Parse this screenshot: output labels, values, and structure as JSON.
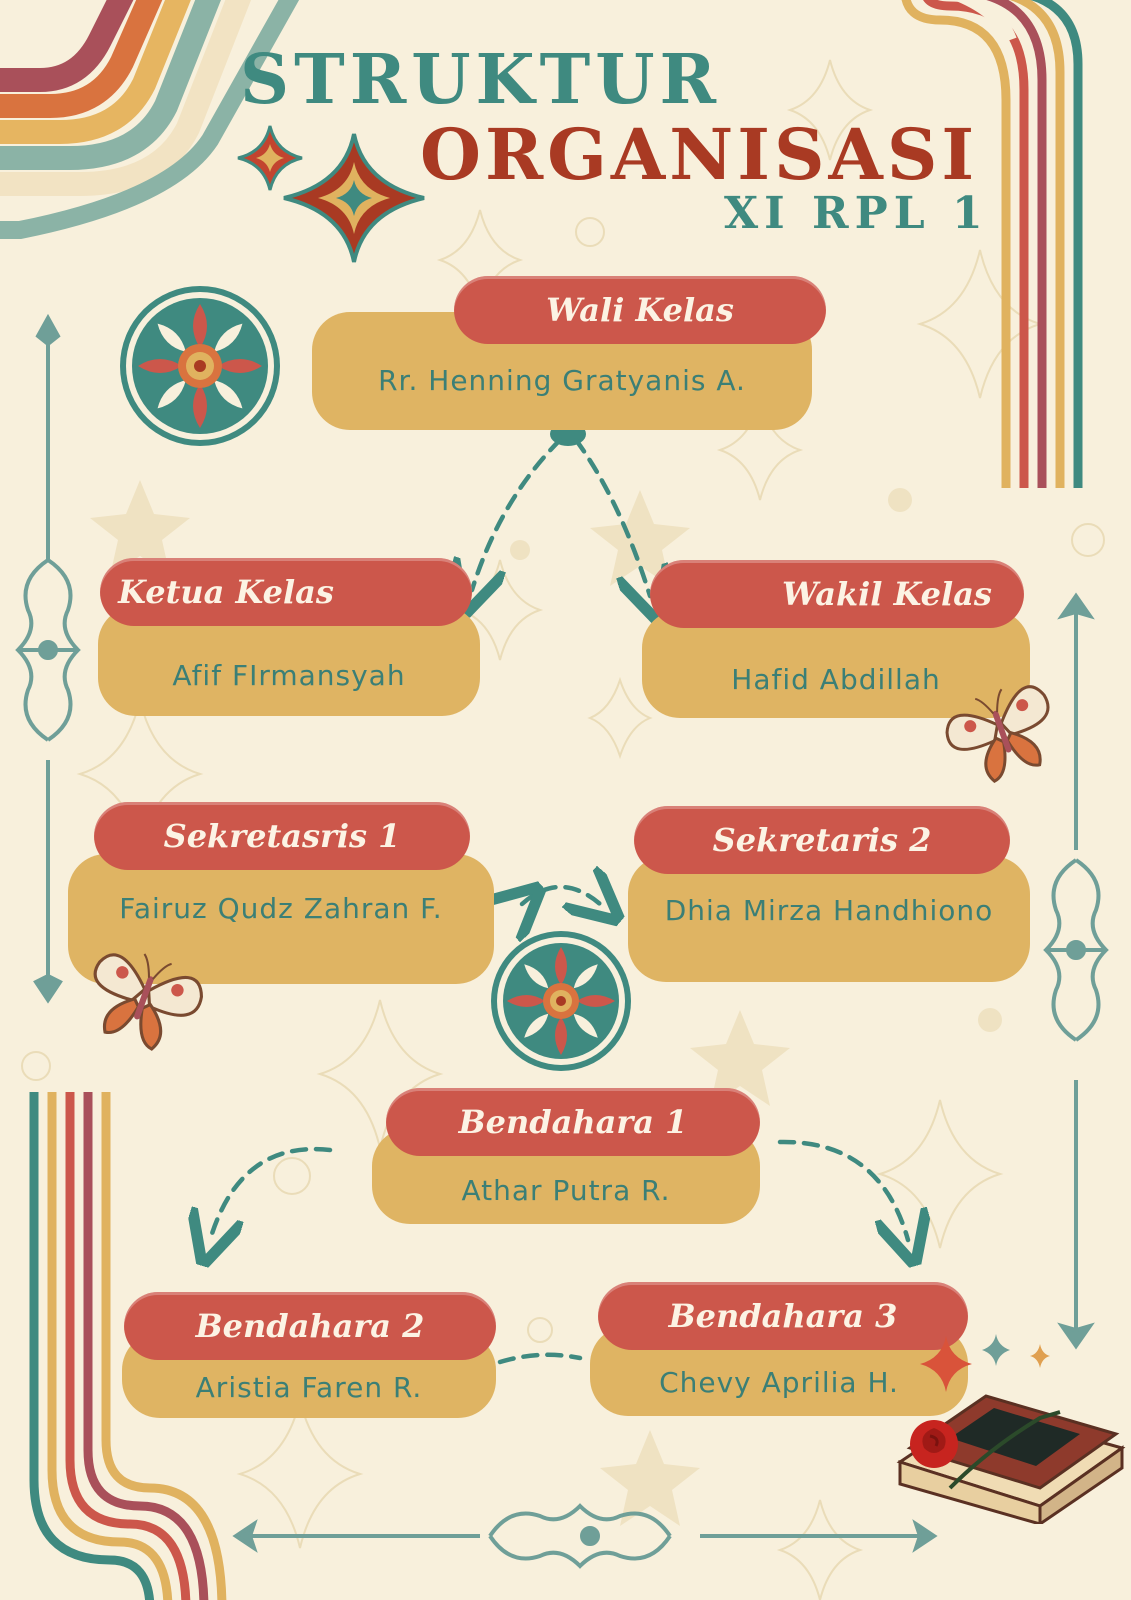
{
  "title": {
    "line1": "STRUKTUR",
    "line2": "ORGANISASI",
    "line3": "XI RPL 1"
  },
  "positions": [
    {
      "id": "wali",
      "role": "Wali Kelas",
      "name": "Rr. Henning Gratyanis A."
    },
    {
      "id": "ketua",
      "role": "Ketua Kelas",
      "name": "Afif FIrmansyah"
    },
    {
      "id": "wakil",
      "role": "Wakil Kelas",
      "name": "Hafid Abdillah"
    },
    {
      "id": "sek1",
      "role": "Sekretasris 1",
      "name": "Fairuz Qudz Zahran F."
    },
    {
      "id": "sek2",
      "role": "Sekretaris 2",
      "name": "Dhia Mirza Handhiono"
    },
    {
      "id": "ben1",
      "role": "Bendahara 1",
      "name": "Athar Putra R."
    },
    {
      "id": "ben2",
      "role": "Bendahara 2",
      "name": "Aristia Faren R."
    },
    {
      "id": "ben3",
      "role": "Bendahara 3",
      "name": "Chevy Aprilia H."
    }
  ],
  "colors": {
    "background": "#f8f0dc",
    "teal": "#3f8a80",
    "red": "#cc574b",
    "mustard": "#dfb463",
    "orange": "#d9733f",
    "maroon": "#a9505a",
    "title_red": "#a93a23"
  },
  "icons": [
    "sparkle-star-icon",
    "mandala-icon",
    "butterfly-icon",
    "book-with-rose-icon",
    "ornamental-scroll-icon",
    "dashed-arrow-icon"
  ]
}
